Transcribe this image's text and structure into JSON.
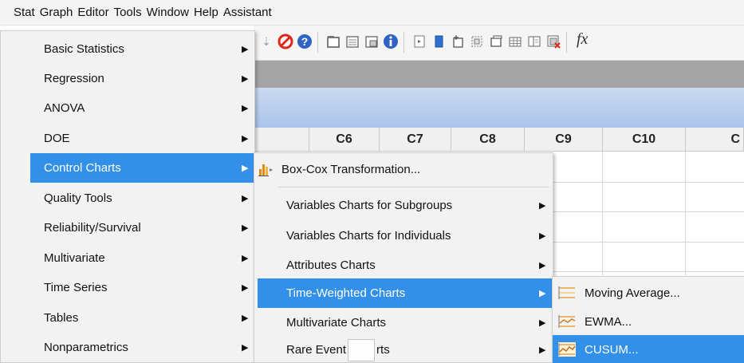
{
  "menubar": {
    "items": [
      "Stat",
      "Graph",
      "Editor",
      "Tools",
      "Window",
      "Help",
      "Assistant"
    ]
  },
  "toolbar": {
    "icons": [
      "pin-icon",
      "stop-icon",
      "help-icon",
      "window-icon",
      "print-icon",
      "print-setup-icon",
      "info-icon",
      "script-icon",
      "blue-bar-icon",
      "new-worksheet-icon",
      "graph-layout-icon",
      "window-tile-icon",
      "table-icon",
      "panel-icon",
      "close-window-icon",
      "formula-icon"
    ],
    "fx_label": "fx"
  },
  "worksheet": {
    "columns": [
      "C6",
      "C7",
      "C8",
      "C9",
      "C10",
      "C"
    ]
  },
  "stat_menu": {
    "items": [
      {
        "label": "Basic Statistics",
        "has_submenu": true
      },
      {
        "label": "Regression",
        "has_submenu": true
      },
      {
        "label": "ANOVA",
        "has_submenu": true
      },
      {
        "label": "DOE",
        "has_submenu": true
      },
      {
        "label": "Control Charts",
        "has_submenu": true,
        "highlighted": true
      },
      {
        "label": "Quality Tools",
        "has_submenu": true
      },
      {
        "label": "Reliability/Survival",
        "has_submenu": true
      },
      {
        "label": "Multivariate",
        "has_submenu": true
      },
      {
        "label": "Time Series",
        "has_submenu": true
      },
      {
        "label": "Tables",
        "has_submenu": true
      },
      {
        "label": "Nonparametrics",
        "has_submenu": true
      }
    ]
  },
  "control_charts_menu": {
    "box_cox": "Box-Cox Transformation...",
    "items": [
      {
        "label": "Variables Charts for Subgroups",
        "has_submenu": true
      },
      {
        "label": "Variables Charts for Individuals",
        "has_submenu": true
      },
      {
        "label": "Attributes Charts",
        "has_submenu": true
      },
      {
        "label": "Time-Weighted Charts",
        "has_submenu": true,
        "highlighted": true
      },
      {
        "label": "Multivariate Charts",
        "has_submenu": true
      }
    ],
    "rare_event_left": "Rare Event",
    "rare_event_right": "rts"
  },
  "time_weighted_menu": {
    "items": [
      {
        "label": "Moving Average..."
      },
      {
        "label": "EWMA..."
      },
      {
        "label": "CUSUM...",
        "highlighted": true
      }
    ]
  },
  "colors": {
    "highlight": "#3390e9",
    "menu_bg": "#f2f2f2",
    "grey_strip": "#a5a5a5",
    "blue_strip": "#b8d0ee"
  }
}
